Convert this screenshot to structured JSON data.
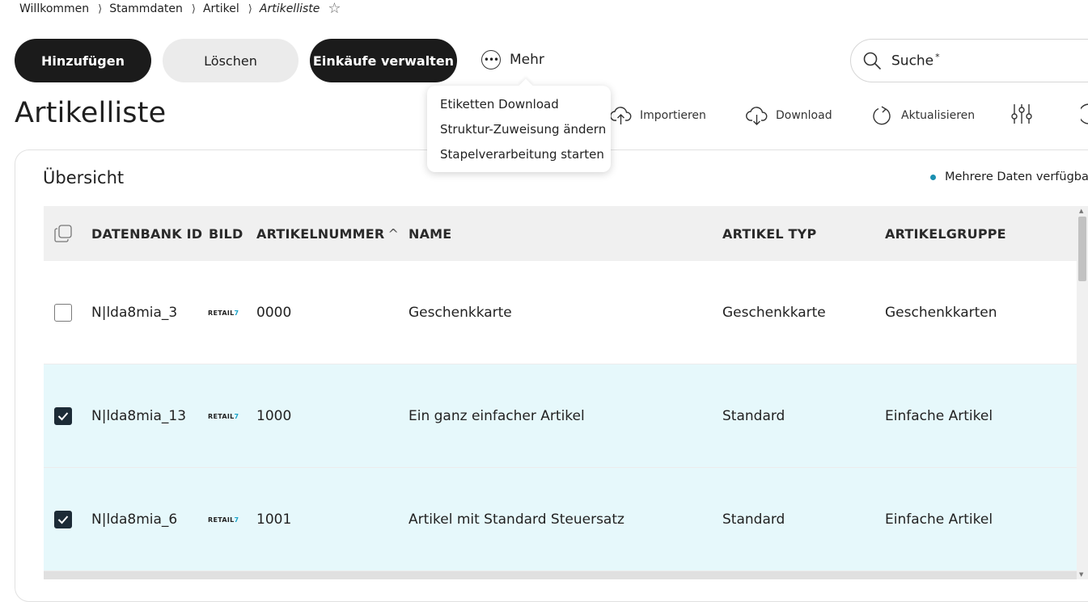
{
  "breadcrumb": {
    "items": [
      "Willkommen",
      "Stammdaten",
      "Artikel"
    ],
    "current": "Artikelliste",
    "separator": "⟩"
  },
  "toolbar": {
    "add_label": "Hinzufügen",
    "delete_label": "Löschen",
    "purchases_label": "Einkäufe verwalten",
    "more_label": "Mehr"
  },
  "search": {
    "label": "Suche",
    "required_mark": "*"
  },
  "page_title": "Artikelliste",
  "actions": {
    "import_label": "Importieren",
    "download_label": "Download",
    "refresh_label": "Aktualisieren"
  },
  "more_menu": {
    "items": [
      "Etiketten Download",
      "Struktur-Zuweisung ändern",
      "Stapelverarbeitung starten"
    ]
  },
  "card": {
    "title": "Übersicht",
    "more_data": "Mehrere Daten verfügbar"
  },
  "table": {
    "columns": [
      "DATENBANK ID",
      "BILD",
      "ARTIKELNUMMER",
      "NAME",
      "ARTIKEL TYP",
      "ARTIKELGRUPPE"
    ],
    "sort_indicator": "^",
    "logo_text": "RETAIL",
    "logo_mark": "7",
    "rows": [
      {
        "checked": false,
        "id": "N|lda8mia_3",
        "number": "0000",
        "name": "Geschenkkarte",
        "type": "Geschenkkarte",
        "group": "Geschenkkarten"
      },
      {
        "checked": true,
        "id": "N|lda8mia_13",
        "number": "1000",
        "name": "Ein ganz einfacher Artikel",
        "type": "Standard",
        "group": "Einfache Artikel"
      },
      {
        "checked": true,
        "id": "N|lda8mia_6",
        "number": "1001",
        "name": "Artikel mit Standard Steuersatz",
        "type": "Standard",
        "group": "Einfache Artikel"
      }
    ]
  },
  "colors": {
    "primary_button": "#1b1b1b",
    "secondary_button": "#ebebeb",
    "selected_row": "#e6f8fb",
    "accent": "#1a8fb0"
  }
}
